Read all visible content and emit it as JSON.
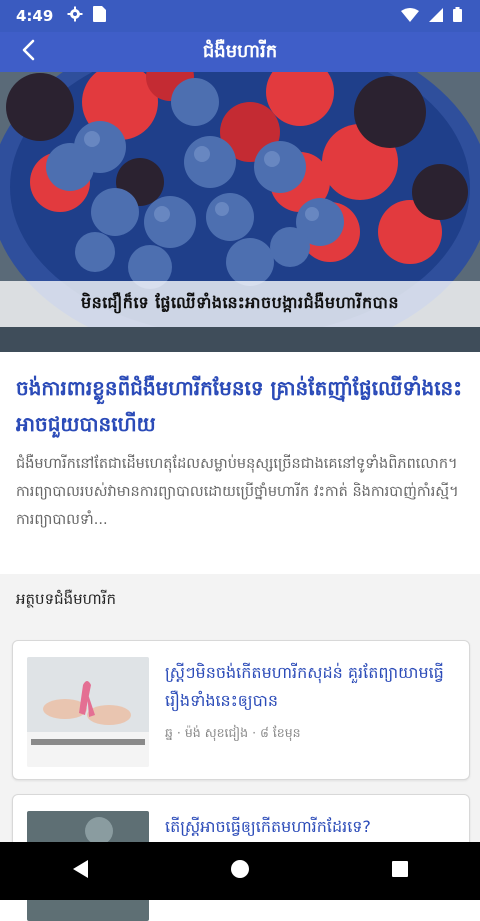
{
  "status_bar": {
    "time": "4:49",
    "icons": [
      "gear-icon",
      "sim-card-icon",
      "wifi-icon",
      "signal-icon",
      "battery-icon"
    ]
  },
  "app_bar": {
    "title": "ជំងឺមហារីក",
    "back_icon": "arrow-back-icon"
  },
  "hero": {
    "caption": "មិនជឿក៏ទេ ផ្លែឈើទាំងនេះអាចបង្ការជំងឺមហារីកបាន"
  },
  "article": {
    "headline": "ចង់ការពារខ្លួនពីជំងឺមហារីកមែនទេ គ្រាន់តែញ៉ាំផ្លែឈើទាំងនេះអាចជួយបានហើយ",
    "summary": "ជំងឺមហារីកនៅតែជាដើមហេតុដែលសម្លាប់មនុស្សច្រើនជាងគេនៅទូទាំងពិភពលោក។ ការព្យាបាលរបស់វាមានការព្យាបាលដោយប្រើថ្នាំមហារីក វះកាត់ និងការបាញ់កាំរស្មី។ ការព្យាបាលទាំ..."
  },
  "related": {
    "section_title": "អត្ថបទជំងឺមហារីក",
    "items": [
      {
        "title": "ស្រ្តីៗមិនចង់កើតមហារីកសុដន់ គួរតែព្យាយាមធ្វើរឿងទាំងនេះឲ្យបាន",
        "meta": "ឆ្ន · ម៉ង់ សុខជៀង · ៨ ខែមុន"
      },
      {
        "title": "តើស្ត្រីអាចធ្វើឲ្យកើតមហារីកដែរទេ?",
        "meta": ""
      }
    ]
  },
  "nav": {
    "back_icon": "nav-back-triangle-icon",
    "home_icon": "nav-home-circle-icon",
    "recent_icon": "nav-recents-square-icon"
  }
}
